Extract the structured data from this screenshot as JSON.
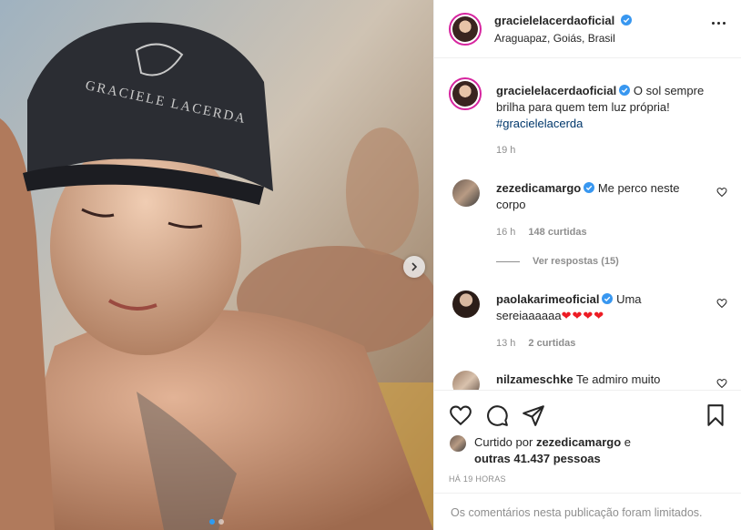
{
  "post": {
    "username": "gracielelacerdaoficial",
    "location": "Araguapaz, Goiás, Brasil",
    "caption": {
      "username": "gracielelacerdaoficial",
      "text": "O sol sempre brilha para quem tem luz própria!",
      "hashtag": "#gracielelacerda",
      "time": "19 h"
    },
    "image": {
      "cap_text": "GRACIELE LACERDA"
    },
    "carousel": {
      "total": 2,
      "current": 1
    }
  },
  "comments": [
    {
      "username": "zezedicamargo",
      "text": "Me perco neste corpo",
      "time": "16 h",
      "likes": "148 curtidas",
      "replies": "Ver respostas (15)"
    },
    {
      "username": "paolakarimeoficial",
      "text": "Uma sereiaaaaaa",
      "emoji": "❤❤❤❤",
      "time": "13 h",
      "likes": "2 curtidas"
    },
    {
      "username": "nilzameschke",
      "text": "Te admiro muito"
    }
  ],
  "likes": {
    "prefix": "Curtido por",
    "by": "zezedicamargo",
    "conj": "e",
    "others": "outras 41.437 pessoas"
  },
  "timestamp": "HÁ 19 HORAS",
  "comments_limited": "Os comentários nesta publicação foram limitados.",
  "colors": {
    "verified": "#3897f0",
    "heart": "#ed1c24",
    "link": "#00376b",
    "muted": "#8e8e8e",
    "dot_active": "#2e9bf0"
  }
}
